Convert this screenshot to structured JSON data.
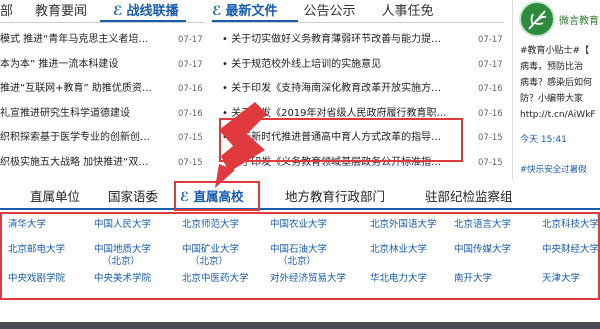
{
  "tabs_left": [
    {
      "label": "部"
    },
    {
      "label": "教育要闻"
    },
    {
      "label": "战线联播",
      "icon": "cap-icon",
      "glyph": "ℰ"
    }
  ],
  "tabs_right": [
    {
      "label": "最新文件",
      "icon": "cap-icon",
      "glyph": "ℰ"
    },
    {
      "label": "公告公示"
    },
    {
      "label": "人事任免"
    }
  ],
  "news_left": [
    {
      "title": "模式 推进“青年马克思主义者培…",
      "date": "07-17"
    },
    {
      "title": "本为本” 推进一流本科建设",
      "date": "07-17"
    },
    {
      "title": "推进“互联网+教育” 助推优质资…",
      "date": "07-16"
    },
    {
      "title": "礼宣推进研究生科学道德建设",
      "date": "07-16"
    },
    {
      "title": "织积探索基于医学专业的创新创…",
      "date": "07-15"
    },
    {
      "title": "织极实施五大战略 加快推进“双…",
      "date": "07-15"
    }
  ],
  "news_right": [
    {
      "title": "关于切实做好义务教育薄弱环节改善与能力提…",
      "date": "07-17"
    },
    {
      "title": "关于规范校外线上培训的实施意见",
      "date": "07-17"
    },
    {
      "title": "关于印发《支持海南深化教育改革开放实施方…",
      "date": "07-16"
    },
    {
      "title": "关于印发《2019年对省级人民政府履行教育职…",
      "date": "07-16"
    },
    {
      "title": "关于新时代推进普通高中育人方式改革的指导…",
      "date": "07-15"
    },
    {
      "title": "关于印发《义务教育领域基层政务公开标准指…",
      "date": "07-15"
    }
  ],
  "weibo": {
    "brand": "微言教育",
    "lines": [
      "#教育小贴士#【",
      "病毒，预防比治",
      "病毒？感染后如何",
      "防？小编带大家",
      "http://t.cn/AiWkF"
    ],
    "time": "今天 15:41",
    "footer": "#快乐安全过暑假"
  },
  "categories": [
    {
      "label": "直属单位"
    },
    {
      "label": "国家语委"
    },
    {
      "label": "直属高校",
      "icon": "cap-icon",
      "glyph": "ℰ"
    },
    {
      "label": "地方教育行政部门"
    },
    {
      "label": "驻部纪检监察组"
    }
  ],
  "universities": [
    [
      "清华大学",
      "中国人民大学",
      "北京师范大学",
      "中国农业大学",
      "北京外国语大学",
      "北京语言大学",
      "北京科技大学"
    ],
    [
      "北京邮电大学",
      "中国地质大学",
      "中国矿业大学",
      "中国石油大学",
      "北京林业大学",
      "中国传媒大学",
      "中央财经大学"
    ],
    [
      "中央戏剧学院",
      "中央美术学院",
      "北京中医药大学",
      "对外经济贸易大学",
      "华北电力大学",
      "南开大学",
      "天津大学"
    ]
  ],
  "uni_subs": {
    "r1c1": "（北京）",
    "r1c2": "（北京）",
    "r1c3": "（北京）"
  },
  "accent": "#1a5cb0",
  "highlight_color": "#e0393e"
}
